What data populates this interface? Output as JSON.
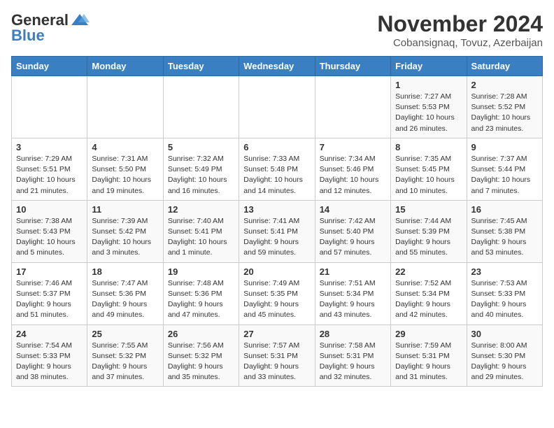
{
  "header": {
    "logo_general": "General",
    "logo_blue": "Blue",
    "title": "November 2024",
    "subtitle": "Cobansignaq, Tovuz, Azerbaijan"
  },
  "days_of_week": [
    "Sunday",
    "Monday",
    "Tuesday",
    "Wednesday",
    "Thursday",
    "Friday",
    "Saturday"
  ],
  "weeks": [
    [
      {
        "day": "",
        "info": ""
      },
      {
        "day": "",
        "info": ""
      },
      {
        "day": "",
        "info": ""
      },
      {
        "day": "",
        "info": ""
      },
      {
        "day": "",
        "info": ""
      },
      {
        "day": "1",
        "info": "Sunrise: 7:27 AM\nSunset: 5:53 PM\nDaylight: 10 hours and 26 minutes."
      },
      {
        "day": "2",
        "info": "Sunrise: 7:28 AM\nSunset: 5:52 PM\nDaylight: 10 hours and 23 minutes."
      }
    ],
    [
      {
        "day": "3",
        "info": "Sunrise: 7:29 AM\nSunset: 5:51 PM\nDaylight: 10 hours and 21 minutes."
      },
      {
        "day": "4",
        "info": "Sunrise: 7:31 AM\nSunset: 5:50 PM\nDaylight: 10 hours and 19 minutes."
      },
      {
        "day": "5",
        "info": "Sunrise: 7:32 AM\nSunset: 5:49 PM\nDaylight: 10 hours and 16 minutes."
      },
      {
        "day": "6",
        "info": "Sunrise: 7:33 AM\nSunset: 5:48 PM\nDaylight: 10 hours and 14 minutes."
      },
      {
        "day": "7",
        "info": "Sunrise: 7:34 AM\nSunset: 5:46 PM\nDaylight: 10 hours and 12 minutes."
      },
      {
        "day": "8",
        "info": "Sunrise: 7:35 AM\nSunset: 5:45 PM\nDaylight: 10 hours and 10 minutes."
      },
      {
        "day": "9",
        "info": "Sunrise: 7:37 AM\nSunset: 5:44 PM\nDaylight: 10 hours and 7 minutes."
      }
    ],
    [
      {
        "day": "10",
        "info": "Sunrise: 7:38 AM\nSunset: 5:43 PM\nDaylight: 10 hours and 5 minutes."
      },
      {
        "day": "11",
        "info": "Sunrise: 7:39 AM\nSunset: 5:42 PM\nDaylight: 10 hours and 3 minutes."
      },
      {
        "day": "12",
        "info": "Sunrise: 7:40 AM\nSunset: 5:41 PM\nDaylight: 10 hours and 1 minute."
      },
      {
        "day": "13",
        "info": "Sunrise: 7:41 AM\nSunset: 5:41 PM\nDaylight: 9 hours and 59 minutes."
      },
      {
        "day": "14",
        "info": "Sunrise: 7:42 AM\nSunset: 5:40 PM\nDaylight: 9 hours and 57 minutes."
      },
      {
        "day": "15",
        "info": "Sunrise: 7:44 AM\nSunset: 5:39 PM\nDaylight: 9 hours and 55 minutes."
      },
      {
        "day": "16",
        "info": "Sunrise: 7:45 AM\nSunset: 5:38 PM\nDaylight: 9 hours and 53 minutes."
      }
    ],
    [
      {
        "day": "17",
        "info": "Sunrise: 7:46 AM\nSunset: 5:37 PM\nDaylight: 9 hours and 51 minutes."
      },
      {
        "day": "18",
        "info": "Sunrise: 7:47 AM\nSunset: 5:36 PM\nDaylight: 9 hours and 49 minutes."
      },
      {
        "day": "19",
        "info": "Sunrise: 7:48 AM\nSunset: 5:36 PM\nDaylight: 9 hours and 47 minutes."
      },
      {
        "day": "20",
        "info": "Sunrise: 7:49 AM\nSunset: 5:35 PM\nDaylight: 9 hours and 45 minutes."
      },
      {
        "day": "21",
        "info": "Sunrise: 7:51 AM\nSunset: 5:34 PM\nDaylight: 9 hours and 43 minutes."
      },
      {
        "day": "22",
        "info": "Sunrise: 7:52 AM\nSunset: 5:34 PM\nDaylight: 9 hours and 42 minutes."
      },
      {
        "day": "23",
        "info": "Sunrise: 7:53 AM\nSunset: 5:33 PM\nDaylight: 9 hours and 40 minutes."
      }
    ],
    [
      {
        "day": "24",
        "info": "Sunrise: 7:54 AM\nSunset: 5:33 PM\nDaylight: 9 hours and 38 minutes."
      },
      {
        "day": "25",
        "info": "Sunrise: 7:55 AM\nSunset: 5:32 PM\nDaylight: 9 hours and 37 minutes."
      },
      {
        "day": "26",
        "info": "Sunrise: 7:56 AM\nSunset: 5:32 PM\nDaylight: 9 hours and 35 minutes."
      },
      {
        "day": "27",
        "info": "Sunrise: 7:57 AM\nSunset: 5:31 PM\nDaylight: 9 hours and 33 minutes."
      },
      {
        "day": "28",
        "info": "Sunrise: 7:58 AM\nSunset: 5:31 PM\nDaylight: 9 hours and 32 minutes."
      },
      {
        "day": "29",
        "info": "Sunrise: 7:59 AM\nSunset: 5:31 PM\nDaylight: 9 hours and 31 minutes."
      },
      {
        "day": "30",
        "info": "Sunrise: 8:00 AM\nSunset: 5:30 PM\nDaylight: 9 hours and 29 minutes."
      }
    ]
  ]
}
